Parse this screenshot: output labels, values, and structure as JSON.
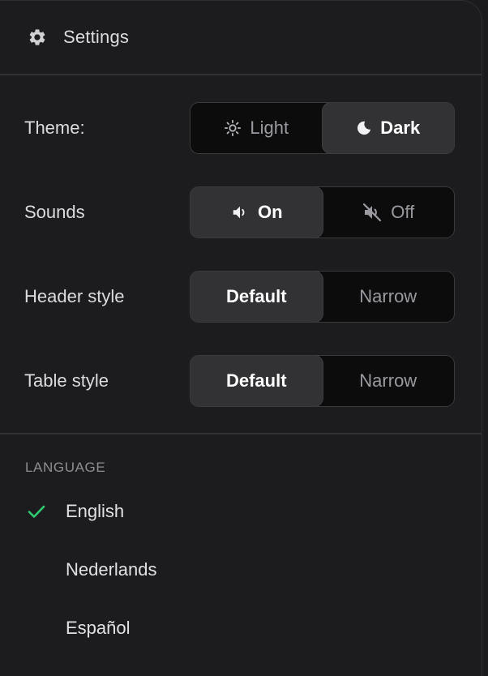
{
  "header": {
    "icon": "gear-icon",
    "title": "Settings"
  },
  "settings": [
    {
      "label": "Theme:",
      "options": [
        {
          "label": "Light",
          "icon": "sun-icon",
          "active": false
        },
        {
          "label": "Dark",
          "icon": "moon-icon",
          "active": true
        }
      ]
    },
    {
      "label": "Sounds",
      "options": [
        {
          "label": "On",
          "icon": "speaker-icon",
          "active": true
        },
        {
          "label": "Off",
          "icon": "speaker-muted-icon",
          "active": false
        }
      ]
    },
    {
      "label": "Header style",
      "options": [
        {
          "label": "Default",
          "active": true
        },
        {
          "label": "Narrow",
          "active": false
        }
      ]
    },
    {
      "label": "Table style",
      "options": [
        {
          "label": "Default",
          "active": true
        },
        {
          "label": "Narrow",
          "active": false
        }
      ]
    }
  ],
  "language": {
    "heading": "LANGUAGE",
    "items": [
      {
        "label": "English",
        "selected": true
      },
      {
        "label": "Nederlands",
        "selected": false
      },
      {
        "label": "Español",
        "selected": false
      }
    ]
  },
  "colors": {
    "background": "#1c1c1e",
    "segment_active": "#323235",
    "segment_track": "#0c0c0d",
    "check": "#2ecc71"
  }
}
